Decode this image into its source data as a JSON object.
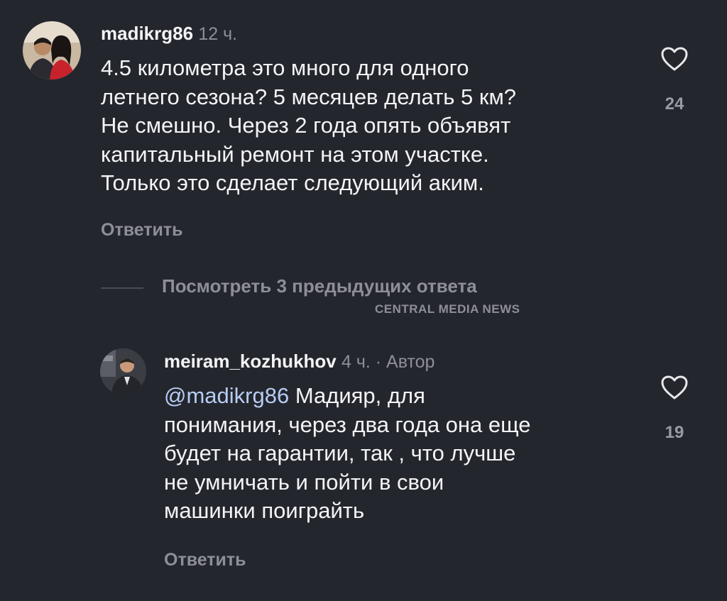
{
  "comments": [
    {
      "username": "madikrg86",
      "time": "12 ч.",
      "text": "4.5 километра это много для одного\nлетнего сезона? 5 месяцев делать 5 км?\nНе смешно. Через 2 года опять объявят\nкапитальный ремонт на этом участке.\nТолько это сделает следующий аким.",
      "reply_label": "Ответить",
      "like_count": "24",
      "like_icon": "heart-outline-icon"
    },
    {
      "username": "meiram_kozhukhov",
      "time": "4 ч. · Автор",
      "mention": "@madikrg86",
      "text_first": " Мадияр, для",
      "text_rest": "понимания, через два года она еще\nбудет на гарантии, так , что лучше\nне умничать и пойти в свои\nмашинки поиграйть",
      "reply_label": "Ответить",
      "like_count": "19",
      "like_icon": "heart-outline-icon"
    }
  ],
  "view_replies_label": "Посмотреть 3 предыдущих ответа",
  "watermark": "CENTRAL MEDIA NEWS",
  "colors": {
    "background": "#24262e",
    "text": "#f4f4f6",
    "secondary": "#8e8f96",
    "mention": "#b7ccf2"
  }
}
